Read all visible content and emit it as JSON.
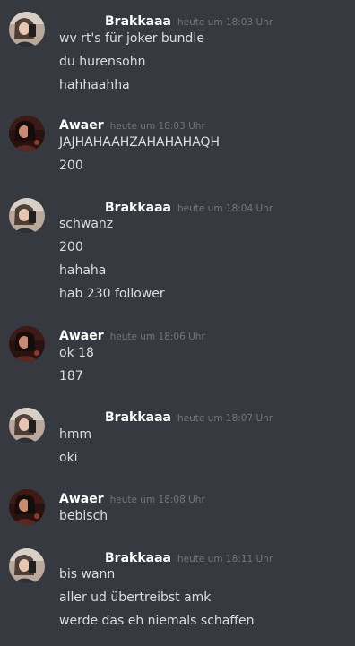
{
  "colors": {
    "background": "#36393f",
    "username": "#ffffff",
    "timestamp": "#72767d",
    "message": "#dcddde"
  },
  "groups": [
    {
      "author": "Brakkaaa",
      "time": "heute um 18:03 Uhr",
      "lines": [
        "wv rt's für joker bundle",
        "du hurensohn",
        "hahhaahha"
      ]
    },
    {
      "author": "Awaer",
      "time": "heute um 18:03 Uhr",
      "lines": [
        "JAJHAHAAHZAHAHAHAQH",
        "200"
      ]
    },
    {
      "author": "Brakkaaa",
      "time": "heute um 18:04 Uhr",
      "lines": [
        "schwanz",
        "200",
        "hahaha",
        "hab 230 follower"
      ]
    },
    {
      "author": "Awaer",
      "time": "heute um 18:06 Uhr",
      "lines": [
        "ok 18",
        "187"
      ]
    },
    {
      "author": "Brakkaaa",
      "time": "heute um 18:07 Uhr",
      "lines": [
        "hmm",
        "oki"
      ]
    },
    {
      "author": "Awaer",
      "time": "heute um 18:08 Uhr",
      "lines": [
        "bebisch"
      ]
    },
    {
      "author": "Brakkaaa",
      "time": "heute um 18:11 Uhr",
      "lines": [
        "bis wann",
        "aller ud übertreibst amk",
        "werde das eh niemals schaffen"
      ]
    }
  ]
}
